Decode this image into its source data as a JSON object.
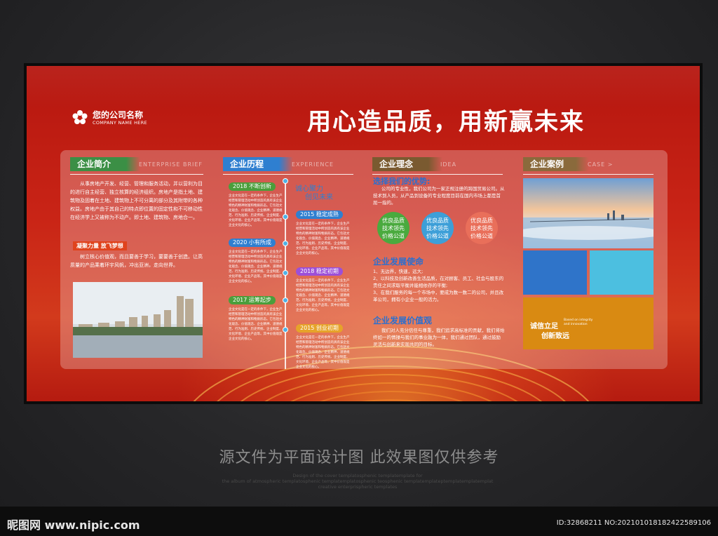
{
  "board": {
    "company_name": "您的公司名称",
    "company_sub": "COMPANY NAME HERE",
    "headline": "用心造品质，用新赢未来"
  },
  "intro": {
    "tag": "企业简介",
    "tag_sub": "ENTERPRISE BRIEF",
    "text": "从事房地产开发、经营、管理和服务活动，并以营利为目的进行自主经营、独立核算的经济组织。房地产是指土地、建筑物及固着在土地、建筑物上不可分离的部分及其附带的各种权益。房地产由于其自己的特点即位置的固定性和不可移动性在经济学上又被称为不动产。即土地、建筑物、房地合一。",
    "subtag": "凝聚力量 放飞梦想",
    "text2": "树立核心价值观，而且要善于学习，要要善于创造。让高质量的产品乘着环宇风帆，冲出亚洲，走向世界。"
  },
  "history": {
    "tag": "企业历程",
    "tag_sub": "EXPERIENCE",
    "slogan1": "诚心聚力",
    "slogan2": "创见未来",
    "milestone_text": "企业文化是在一定的条件下，企业生产经营和管理活动中所创造的具有该企业特色的精神财富和物质形态。它包括文化观念、价值观念、企业精神、道德规范、行为准则、历史传统、企业制度、文化环境、企业产品等。其中价值观是企业文化的核心。",
    "milestones": [
      {
        "label": "2018 不断创新",
        "color": "#4a9e3b"
      },
      {
        "label": "2015 稳定成熟",
        "color": "#2f7fd0"
      },
      {
        "label": "2020 小有所成",
        "color": "#2f7fd0"
      },
      {
        "label": "2018 稳定初期",
        "color": "#9c4fd8"
      },
      {
        "label": "2017 运筹起步",
        "color": "#4a9e3b"
      },
      {
        "label": "2015 创业初期",
        "color": "#e6a32a"
      }
    ]
  },
  "philosophy": {
    "tag": "企业理念",
    "tag_sub": "IDEA",
    "advantage_title": "选择我们的优势:",
    "advantage_text": "公司的专业性，我们公司为一家正规注册的跨国贸易公司。从技术到人员，从产品到设备的专业程度目前在国内市场上都是首屈一指的。",
    "circles": [
      {
        "text": "优良品质技术领先价格公道",
        "color": "#4aaa3e"
      },
      {
        "text": "优良品质技术领先价格公道",
        "color": "#3d9fd8"
      },
      {
        "text": "优良品质技术领先价格公道",
        "color": "#e96f5a"
      }
    ],
    "mission_title": "企业发展使命",
    "mission_items": [
      "1、无边界，快速，远大;",
      "2、以科技及创新改善生活品质，在对顾客、员工、社会与股东的责任之间求取平衡并能相依存的平衡;",
      "3、在我们服务的每一个市场中，要成为数一数二的公司，并且改革公司，拥有小企业一般的活力。"
    ],
    "values_title": "企业发展价值观",
    "values_text": "我们对人充分信任与尊重，我们追求高标准的贡献，我们将始终如一的情操与我们的事业融为一体，我们通过团队，通过鼓励灵活与创新来实现共同的目标。"
  },
  "cases": {
    "tag": "企业案例",
    "tag_sub": "CASE >",
    "tile_title": "诚信立足",
    "tile_sub1": "Based on integrity",
    "tile_sub2": "and innovation",
    "tile_title2": "创新致远",
    "colors": {
      "blue": "#2f74c9",
      "cyan": "#4cbfe0",
      "orange": "#d98a12"
    }
  },
  "footer": {
    "caption": "源文件为平面设计图  此效果图仅供参考",
    "watermark1": "Design of the cover templatosphenic templatemplate for",
    "watermark2": "the album of atmospheric templatosphenic templatemplatosphenic teosphenic templatemplateptemplatemplatemplat",
    "watermark3": "creative enterprispheric templates",
    "site": "昵图网 www.nipic.com",
    "id": "ID:32868211 NO:20210101818242258910​6"
  }
}
